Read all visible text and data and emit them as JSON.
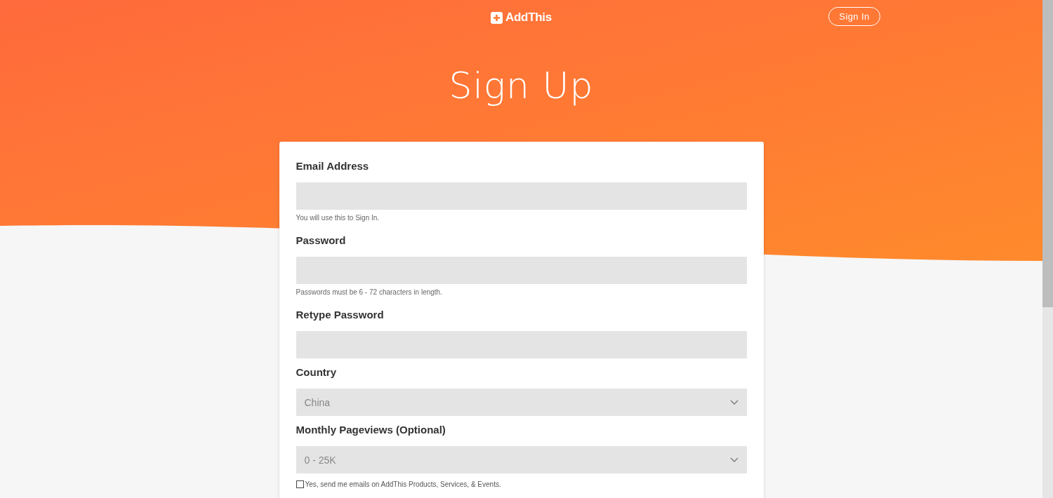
{
  "header": {
    "logo": "AddThis",
    "sign_in_button": "Sign In"
  },
  "title": "Sign Up",
  "form": {
    "fields": [
      {
        "kind": "input",
        "label": "Email Address",
        "hint": "You will use this to Sign In."
      },
      {
        "kind": "input",
        "label": "Password",
        "hint": "Passwords must be 6 - 72 characters in length."
      },
      {
        "kind": "input",
        "label": "Retype Password"
      },
      {
        "kind": "select",
        "label": "Country",
        "value": "China"
      },
      {
        "kind": "select",
        "label": "Monthly Pageviews (Optional)",
        "value": "0 - 25K"
      },
      {
        "kind": "checkbox",
        "label": "Yes, send me emails on AddThis Products, Services, & Events.",
        "checked": false
      }
    ]
  }
}
